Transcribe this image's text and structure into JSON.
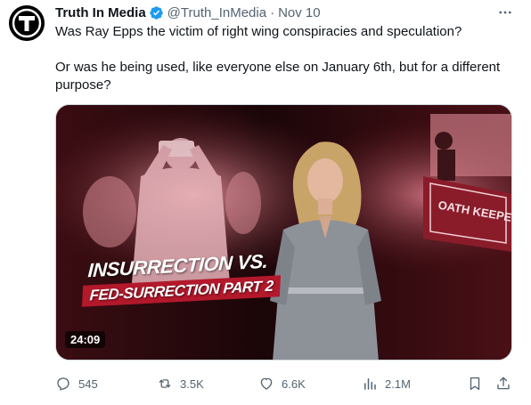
{
  "tweet": {
    "display_name": "Truth In Media",
    "handle": "@Truth_InMedia",
    "separator": "·",
    "date": "Nov 10",
    "text_line1": "Was Ray Epps the victim of right wing conspiracies and speculation?",
    "text_line2": "Or was he being used, like everyone else on January 6th, but for a different",
    "text_line3": "purpose?"
  },
  "media": {
    "headline1": "INSURRECTION VS.",
    "headline2": "FED-SURRECTION PART 2",
    "duration": "24:09",
    "banner_text": "OATH KEEPER"
  },
  "stats": {
    "replies": "545",
    "retweets": "3.5K",
    "likes": "6.6K",
    "views": "2.1M"
  },
  "icons": {
    "avatar": "truth-in-media-logo",
    "verified": "verified-badge-icon",
    "more": "more-icon",
    "reply": "reply-icon",
    "retweet": "retweet-icon",
    "like": "heart-icon",
    "views": "views-icon",
    "bookmark": "bookmark-icon",
    "share": "share-icon"
  },
  "colors": {
    "text_primary": "#0f1419",
    "text_secondary": "#536471",
    "verified": "#1d9bf0",
    "headline_bg": "#b3182b"
  }
}
